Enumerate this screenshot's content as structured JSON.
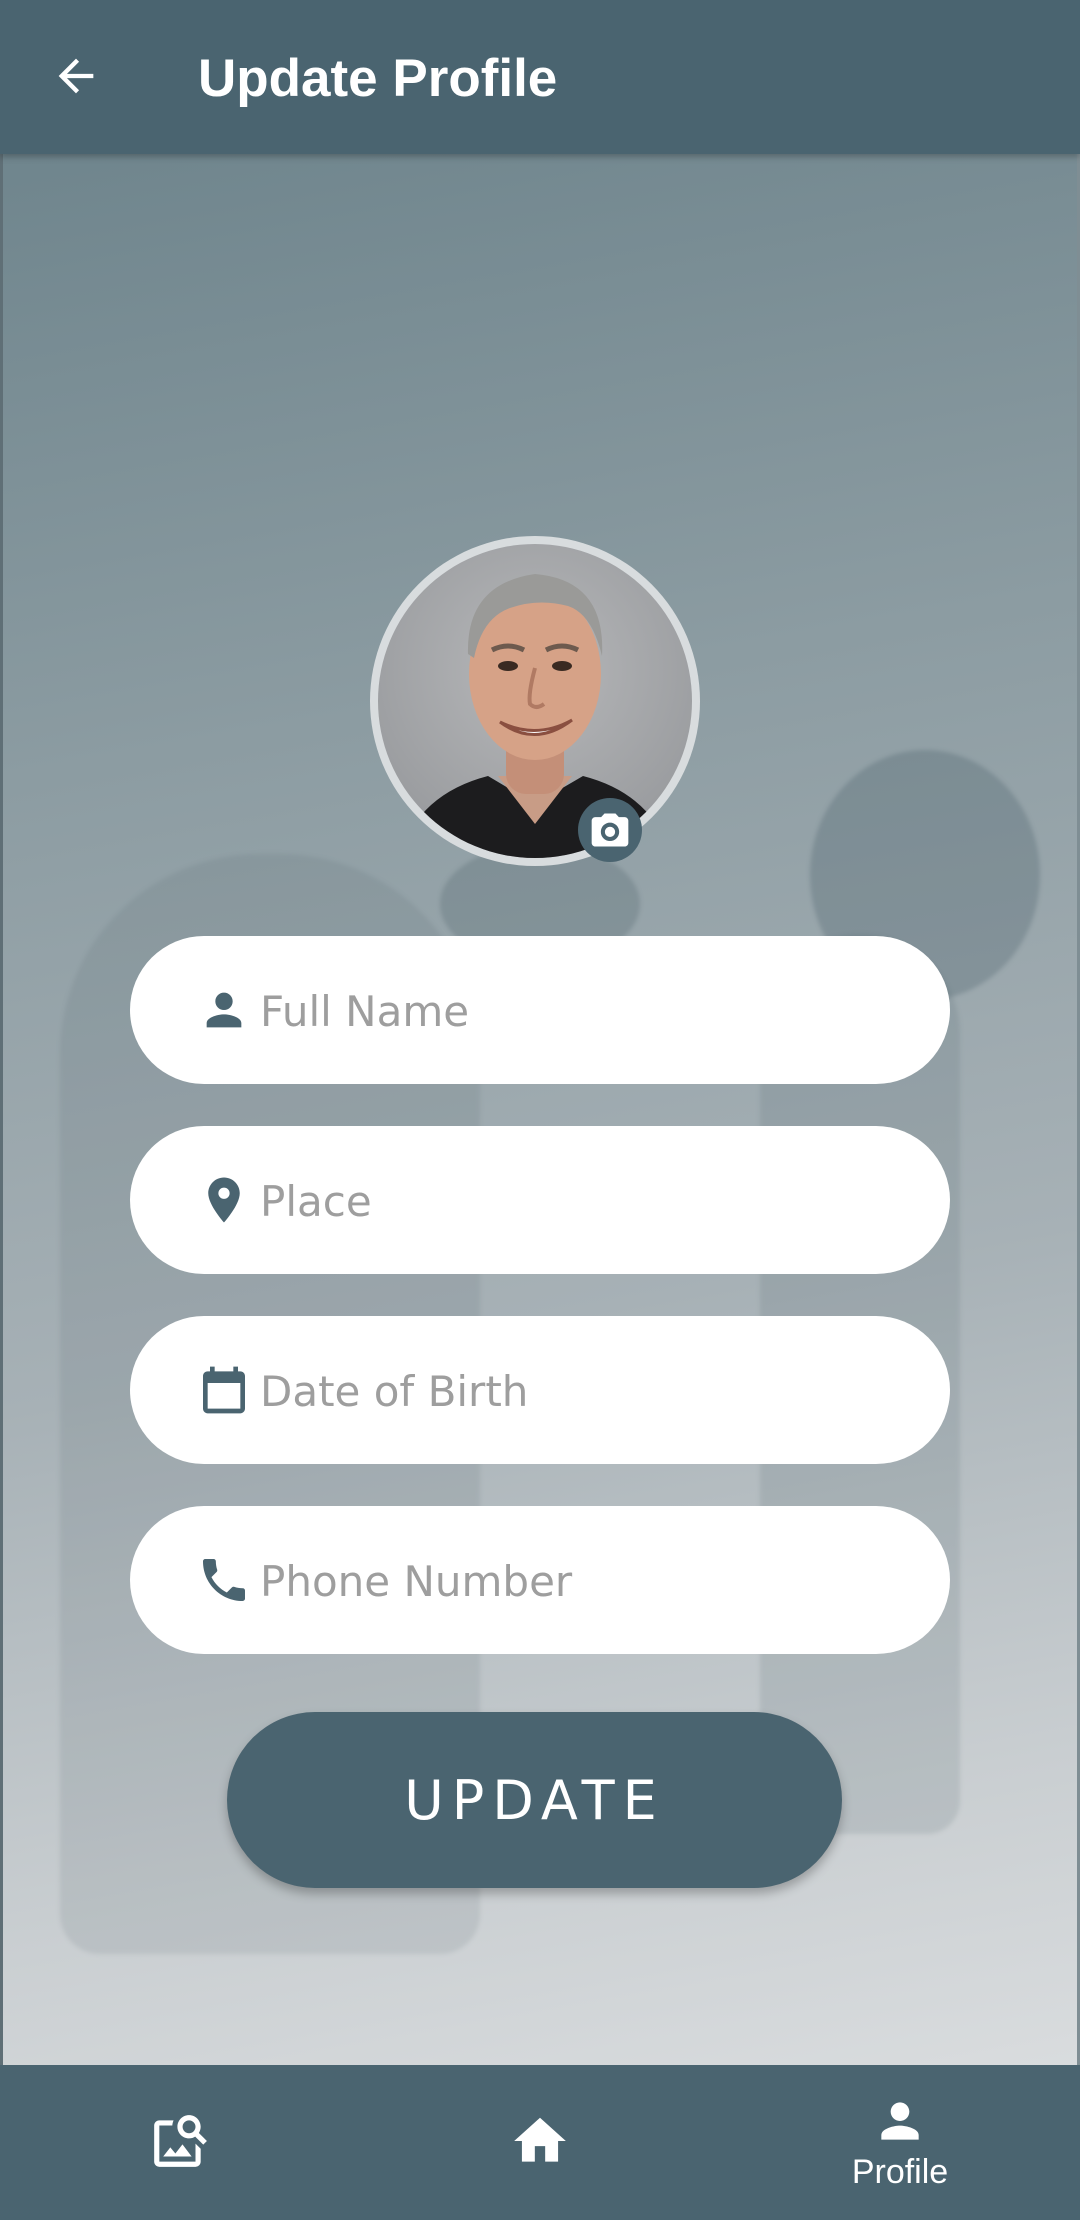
{
  "appbar": {
    "title": "Update Profile",
    "back_icon": "arrow-left-icon"
  },
  "profile": {
    "avatar_alt": "Profile photo",
    "camera_icon": "camera-icon"
  },
  "form": {
    "full_name": {
      "placeholder": "Full Name",
      "value": "",
      "icon": "person-icon"
    },
    "place": {
      "placeholder": "Place",
      "value": "",
      "icon": "location-pin-icon"
    },
    "dob": {
      "placeholder": "Date of Birth",
      "value": "",
      "icon": "calendar-icon"
    },
    "phone": {
      "placeholder": "Phone Number",
      "value": "",
      "icon": "phone-icon"
    }
  },
  "update_button": {
    "label": "UPDATE"
  },
  "bottom_nav": {
    "items": [
      {
        "id": "gallery",
        "icon": "image-search-icon",
        "label": ""
      },
      {
        "id": "home",
        "icon": "home-icon",
        "label": ""
      },
      {
        "id": "profile",
        "icon": "person-icon",
        "label": "Profile"
      }
    ]
  },
  "colors": {
    "primary": "#4a6470",
    "field_bg": "#ffffff",
    "placeholder": "#9e9e9e",
    "icon": "#4a6470"
  }
}
